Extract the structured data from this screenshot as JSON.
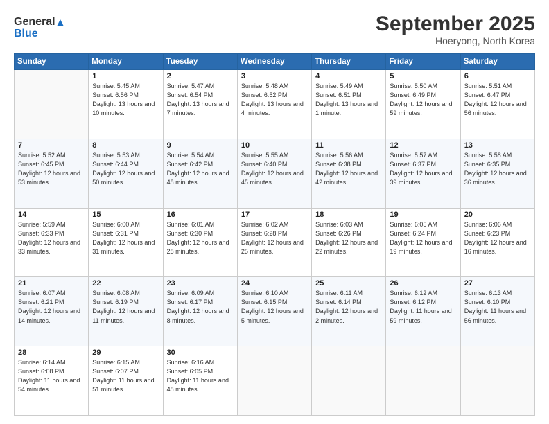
{
  "header": {
    "logo_line1": "General",
    "logo_line2": "Blue",
    "month": "September 2025",
    "location": "Hoeryong, North Korea"
  },
  "weekdays": [
    "Sunday",
    "Monday",
    "Tuesday",
    "Wednesday",
    "Thursday",
    "Friday",
    "Saturday"
  ],
  "weeks": [
    [
      {
        "day": "",
        "info": ""
      },
      {
        "day": "1",
        "info": "Sunrise: 5:45 AM\nSunset: 6:56 PM\nDaylight: 13 hours\nand 10 minutes."
      },
      {
        "day": "2",
        "info": "Sunrise: 5:47 AM\nSunset: 6:54 PM\nDaylight: 13 hours\nand 7 minutes."
      },
      {
        "day": "3",
        "info": "Sunrise: 5:48 AM\nSunset: 6:52 PM\nDaylight: 13 hours\nand 4 minutes."
      },
      {
        "day": "4",
        "info": "Sunrise: 5:49 AM\nSunset: 6:51 PM\nDaylight: 13 hours\nand 1 minute."
      },
      {
        "day": "5",
        "info": "Sunrise: 5:50 AM\nSunset: 6:49 PM\nDaylight: 12 hours\nand 59 minutes."
      },
      {
        "day": "6",
        "info": "Sunrise: 5:51 AM\nSunset: 6:47 PM\nDaylight: 12 hours\nand 56 minutes."
      }
    ],
    [
      {
        "day": "7",
        "info": "Sunrise: 5:52 AM\nSunset: 6:45 PM\nDaylight: 12 hours\nand 53 minutes."
      },
      {
        "day": "8",
        "info": "Sunrise: 5:53 AM\nSunset: 6:44 PM\nDaylight: 12 hours\nand 50 minutes."
      },
      {
        "day": "9",
        "info": "Sunrise: 5:54 AM\nSunset: 6:42 PM\nDaylight: 12 hours\nand 48 minutes."
      },
      {
        "day": "10",
        "info": "Sunrise: 5:55 AM\nSunset: 6:40 PM\nDaylight: 12 hours\nand 45 minutes."
      },
      {
        "day": "11",
        "info": "Sunrise: 5:56 AM\nSunset: 6:38 PM\nDaylight: 12 hours\nand 42 minutes."
      },
      {
        "day": "12",
        "info": "Sunrise: 5:57 AM\nSunset: 6:37 PM\nDaylight: 12 hours\nand 39 minutes."
      },
      {
        "day": "13",
        "info": "Sunrise: 5:58 AM\nSunset: 6:35 PM\nDaylight: 12 hours\nand 36 minutes."
      }
    ],
    [
      {
        "day": "14",
        "info": "Sunrise: 5:59 AM\nSunset: 6:33 PM\nDaylight: 12 hours\nand 33 minutes."
      },
      {
        "day": "15",
        "info": "Sunrise: 6:00 AM\nSunset: 6:31 PM\nDaylight: 12 hours\nand 31 minutes."
      },
      {
        "day": "16",
        "info": "Sunrise: 6:01 AM\nSunset: 6:30 PM\nDaylight: 12 hours\nand 28 minutes."
      },
      {
        "day": "17",
        "info": "Sunrise: 6:02 AM\nSunset: 6:28 PM\nDaylight: 12 hours\nand 25 minutes."
      },
      {
        "day": "18",
        "info": "Sunrise: 6:03 AM\nSunset: 6:26 PM\nDaylight: 12 hours\nand 22 minutes."
      },
      {
        "day": "19",
        "info": "Sunrise: 6:05 AM\nSunset: 6:24 PM\nDaylight: 12 hours\nand 19 minutes."
      },
      {
        "day": "20",
        "info": "Sunrise: 6:06 AM\nSunset: 6:23 PM\nDaylight: 12 hours\nand 16 minutes."
      }
    ],
    [
      {
        "day": "21",
        "info": "Sunrise: 6:07 AM\nSunset: 6:21 PM\nDaylight: 12 hours\nand 14 minutes."
      },
      {
        "day": "22",
        "info": "Sunrise: 6:08 AM\nSunset: 6:19 PM\nDaylight: 12 hours\nand 11 minutes."
      },
      {
        "day": "23",
        "info": "Sunrise: 6:09 AM\nSunset: 6:17 PM\nDaylight: 12 hours\nand 8 minutes."
      },
      {
        "day": "24",
        "info": "Sunrise: 6:10 AM\nSunset: 6:15 PM\nDaylight: 12 hours\nand 5 minutes."
      },
      {
        "day": "25",
        "info": "Sunrise: 6:11 AM\nSunset: 6:14 PM\nDaylight: 12 hours\nand 2 minutes."
      },
      {
        "day": "26",
        "info": "Sunrise: 6:12 AM\nSunset: 6:12 PM\nDaylight: 11 hours\nand 59 minutes."
      },
      {
        "day": "27",
        "info": "Sunrise: 6:13 AM\nSunset: 6:10 PM\nDaylight: 11 hours\nand 56 minutes."
      }
    ],
    [
      {
        "day": "28",
        "info": "Sunrise: 6:14 AM\nSunset: 6:08 PM\nDaylight: 11 hours\nand 54 minutes."
      },
      {
        "day": "29",
        "info": "Sunrise: 6:15 AM\nSunset: 6:07 PM\nDaylight: 11 hours\nand 51 minutes."
      },
      {
        "day": "30",
        "info": "Sunrise: 6:16 AM\nSunset: 6:05 PM\nDaylight: 11 hours\nand 48 minutes."
      },
      {
        "day": "",
        "info": ""
      },
      {
        "day": "",
        "info": ""
      },
      {
        "day": "",
        "info": ""
      },
      {
        "day": "",
        "info": ""
      }
    ]
  ]
}
